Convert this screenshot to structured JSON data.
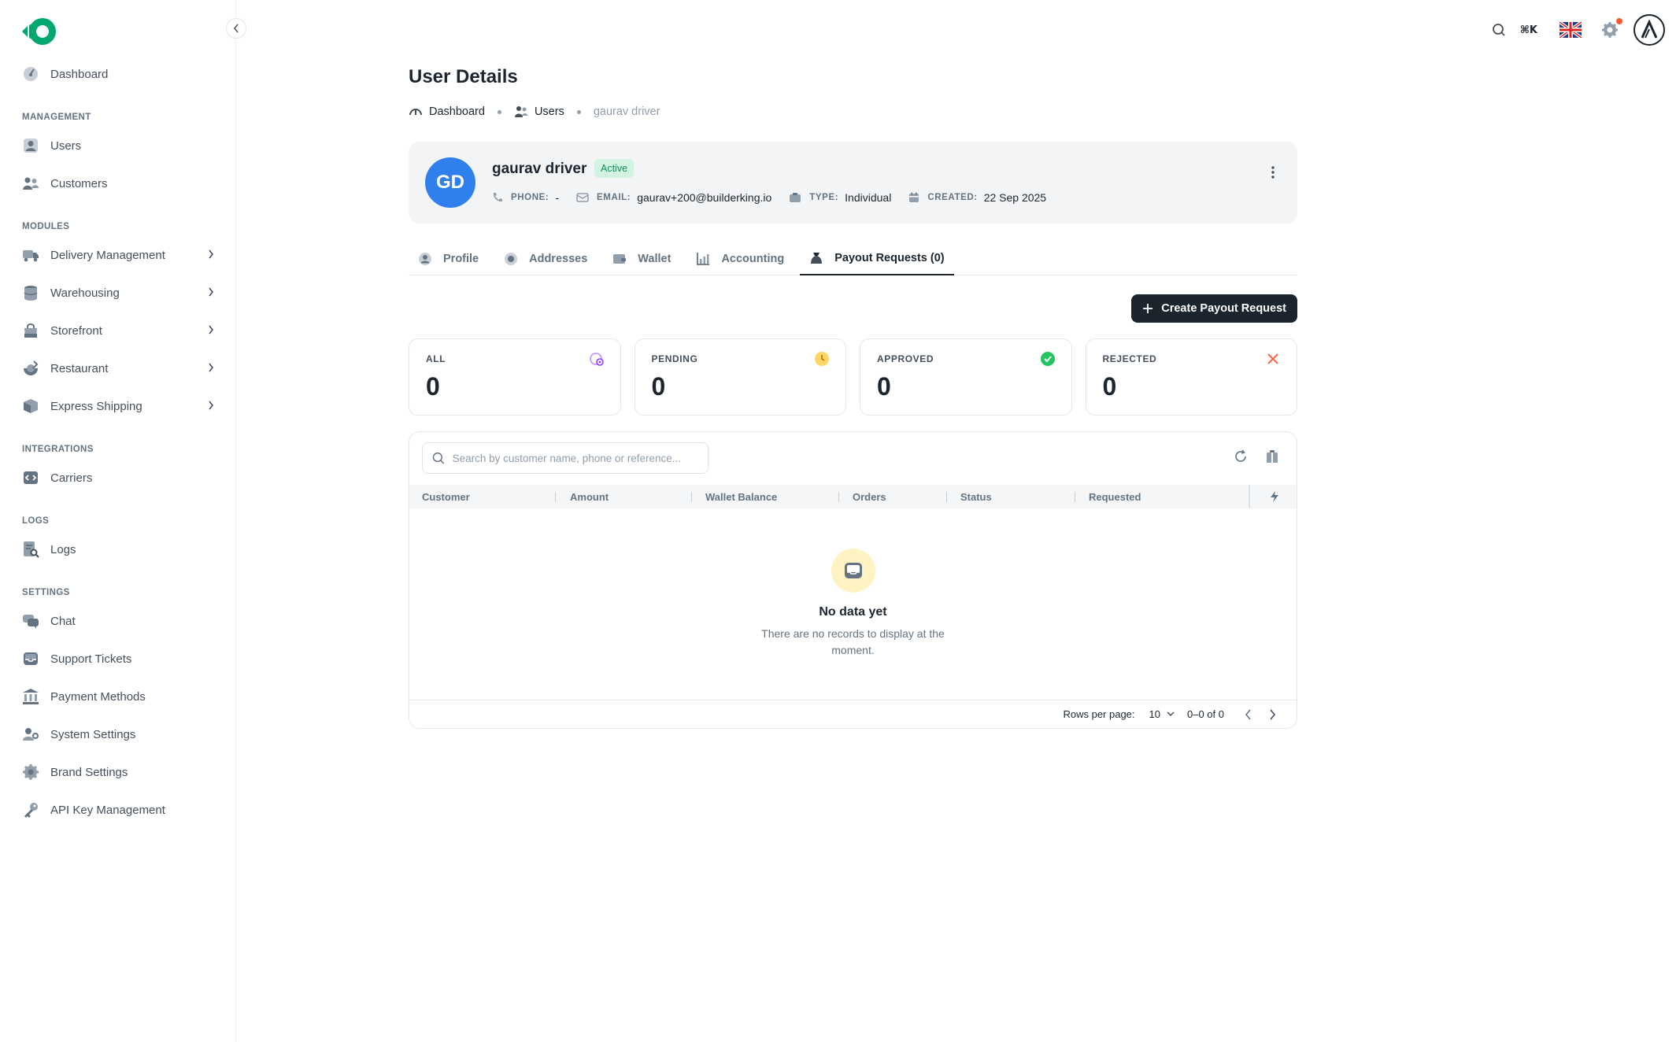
{
  "sidebar": {
    "items": [
      {
        "label": "Dashboard"
      },
      {
        "section": "MANAGEMENT"
      },
      {
        "label": "Users"
      },
      {
        "label": "Customers"
      },
      {
        "section": "MODULES"
      },
      {
        "label": "Delivery Management"
      },
      {
        "label": "Warehousing"
      },
      {
        "label": "Storefront"
      },
      {
        "label": "Restaurant"
      },
      {
        "label": "Express Shipping"
      },
      {
        "section": "INTEGRATIONS"
      },
      {
        "label": "Carriers"
      },
      {
        "section": "LOGS"
      },
      {
        "label": "Logs"
      },
      {
        "section": "SETTINGS"
      },
      {
        "label": "Chat"
      },
      {
        "label": "Support Tickets"
      },
      {
        "label": "Payment Methods"
      },
      {
        "label": "System Settings"
      },
      {
        "label": "Brand Settings"
      },
      {
        "label": "API Key Management"
      }
    ]
  },
  "topbar": {
    "shortcut": "⌘K"
  },
  "page": {
    "title": "User Details",
    "breadcrumb": [
      "Dashboard",
      "Users",
      "gaurav driver"
    ]
  },
  "user": {
    "initials": "GD",
    "name": "gaurav driver",
    "status": "Active",
    "phone_label": "PHONE:",
    "phone": "-",
    "email_label": "EMAIL:",
    "email": "gaurav+200@builderking.io",
    "type_label": "TYPE:",
    "type": "Individual",
    "created_label": "CREATED:",
    "created": "22 Sep 2025"
  },
  "tabs": [
    "Profile",
    "Addresses",
    "Wallet",
    "Accounting",
    "Payout Requests (0)"
  ],
  "actions": {
    "create": "Create Payout Request"
  },
  "stats": [
    {
      "label": "ALL",
      "value": "0",
      "color": "#8e33ff"
    },
    {
      "label": "PENDING",
      "value": "0",
      "color": "#ffab00"
    },
    {
      "label": "APPROVED",
      "value": "0",
      "color": "#22c55e"
    },
    {
      "label": "REJECTED",
      "value": "0",
      "color": "#ff5630"
    }
  ],
  "table": {
    "search_placeholder": "Search by customer name, phone or reference...",
    "columns": [
      "Customer",
      "Amount",
      "Wallet Balance",
      "Orders",
      "Status",
      "Requested"
    ],
    "empty_title": "No data yet",
    "empty_desc": "There are no records to display at the moment.",
    "rows_per_page_label": "Rows per page:",
    "rows_per_page": "10",
    "range": "0–0 of 0"
  }
}
